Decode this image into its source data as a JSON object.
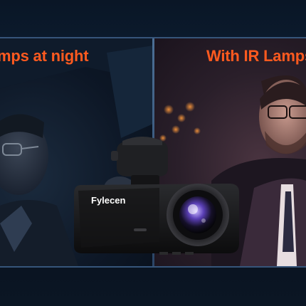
{
  "captions": {
    "left": "mps at night",
    "right": "With IR Lamps"
  },
  "camera": {
    "brand": "Fylecen"
  },
  "colors": {
    "caption": "#ff5a1f",
    "frame": "#36557a",
    "background": "#0a1626"
  }
}
